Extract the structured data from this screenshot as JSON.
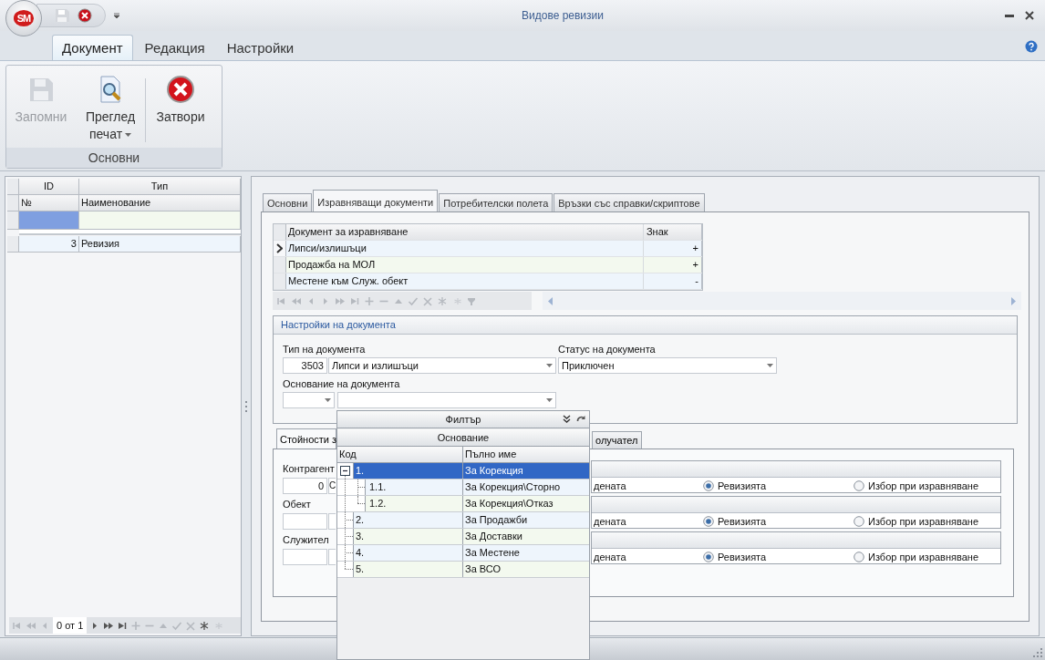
{
  "window": {
    "title": "Видове ревизии",
    "logo_text": "SM"
  },
  "ribbon": {
    "tabs": [
      {
        "label": "Документ",
        "selected": true
      },
      {
        "label": "Редакция",
        "selected": false
      },
      {
        "label": "Настройки",
        "selected": false
      }
    ],
    "group": {
      "label": "Основни",
      "buttons": [
        {
          "kind": "save",
          "label": "Запомни",
          "disabled": true,
          "dropdown": false
        },
        {
          "kind": "preview",
          "label": "Преглед печат",
          "disabled": false,
          "dropdown": true
        },
        {
          "kind": "close",
          "label": "Затвори",
          "disabled": false,
          "dropdown": false
        }
      ]
    }
  },
  "left_grid": {
    "header_rows": [
      [
        "ID",
        "Тип"
      ],
      [
        "№",
        "Наименование"
      ]
    ],
    "rows": [
      {
        "id": "3",
        "type": "Ревизия"
      }
    ],
    "pager": "0 от 1"
  },
  "detail_tabs": [
    {
      "label": "Основни",
      "selected": false
    },
    {
      "label": "Изравняващи документи",
      "selected": true
    },
    {
      "label": "Потребителски полета",
      "selected": false
    },
    {
      "label": "Връзки със справки/скриптове",
      "selected": false
    }
  ],
  "compare_grid": {
    "columns": [
      "Документ за изравняване",
      "Знак"
    ],
    "rows": [
      {
        "document": "Липси/излишъци",
        "sign": "+",
        "selected": true
      },
      {
        "document": "Продажба на МОЛ",
        "sign": "+",
        "selected": false
      },
      {
        "document": "Местене към Служ. обект",
        "sign": "-",
        "selected": false
      }
    ]
  },
  "settings": {
    "title": "Настройки на документа",
    "type_label": "Тип на документа",
    "type_code": "3503",
    "type_name": "Липси и излишъци",
    "status_label": "Статус на документа",
    "status": "Приключен",
    "basis_label": "Основание на документа"
  },
  "values_tabs": [
    {
      "label": "Стойности з",
      "selected": true
    },
    {
      "label": "олучател",
      "selected": false
    }
  ],
  "values_rows": [
    {
      "label": "Контрагент",
      "code": "0",
      "name": "С",
      "option_fragment": "дената",
      "options": [
        {
          "label": "Ревизията",
          "selected": true
        },
        {
          "label": "Избор при изравняване",
          "selected": false
        }
      ]
    },
    {
      "label": "Обект",
      "code": "",
      "name": "",
      "option_fragment": "дената",
      "options": [
        {
          "label": "Ревизията",
          "selected": true
        },
        {
          "label": "Избор при изравняване",
          "selected": false
        }
      ]
    },
    {
      "label": "Служител",
      "code": "",
      "name": "",
      "option_fragment": "дената",
      "options": [
        {
          "label": "Ревизията",
          "selected": true
        },
        {
          "label": "Избор при изравняване",
          "selected": false
        }
      ]
    }
  ],
  "popup": {
    "title": "Филтър",
    "band": "Основание",
    "columns": [
      "Код",
      "Пълно име"
    ],
    "items": [
      {
        "code": "1.",
        "name": "За Корекция",
        "selected": true,
        "expanded": true,
        "children": [
          {
            "code": "1.1.",
            "name": "За Корекция\\Сторно",
            "selected": false
          },
          {
            "code": "1.2.",
            "name": "За Корекция\\Отказ",
            "selected": false
          }
        ]
      },
      {
        "code": "2.",
        "name": "За Продажби",
        "selected": false,
        "expanded": false
      },
      {
        "code": "3.",
        "name": "За Доставки",
        "selected": false,
        "expanded": false
      },
      {
        "code": "4.",
        "name": "За Местене",
        "selected": false,
        "expanded": false
      },
      {
        "code": "5.",
        "name": "За ВСО",
        "selected": false,
        "expanded": false
      }
    ]
  }
}
